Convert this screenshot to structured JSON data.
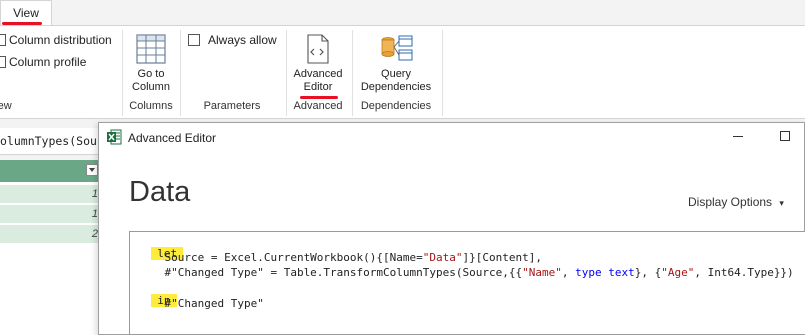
{
  "ribbon": {
    "view_tab": "View",
    "view_group": {
      "column_distribution": "Column distribution",
      "column_profile": "Column profile",
      "label": "View"
    },
    "columns_group": {
      "go_to_column_line1": "Go to",
      "go_to_column_line2": "Column",
      "label": "Columns"
    },
    "parameters_group": {
      "always_allow": "Always allow",
      "label": "Parameters"
    },
    "advanced_group": {
      "advanced_editor_line1": "Advanced",
      "advanced_editor_line2": "Editor",
      "label": "Advanced"
    },
    "dependencies_group": {
      "query_dependencies_line1": "Query",
      "query_dependencies_line2": "Dependencies",
      "label": "Dependencies"
    }
  },
  "background": {
    "formula_text": "olumnTypes(Sour",
    "grid_values": [
      "1",
      "1",
      "2"
    ]
  },
  "dialog": {
    "title": "Advanced Editor",
    "heading": "Data",
    "display_options": "Display Options",
    "code": {
      "let_keyword": "let",
      "line1_prefix": "    Source = Excel.CurrentWorkbook(){[Name=",
      "line1_string": "\"Data\"",
      "line1_suffix": "]}[Content],",
      "line2_prefix": "    #\"Changed Type\" = Table.TransformColumnTypes(Source,{{",
      "line2_s1": "\"Name\"",
      "line2_mid1": ", ",
      "line2_type1": "type text",
      "line2_mid2": "}, {",
      "line2_s2": "\"Age\"",
      "line2_suffix": ", Int64.Type}})",
      "in_keyword": "in",
      "line3": "    #\"Changed Type\""
    }
  },
  "colors": {
    "accent_red": "#e81123",
    "keyword_highlight": "#ffeb3b",
    "grid_header": "#6aa786"
  }
}
